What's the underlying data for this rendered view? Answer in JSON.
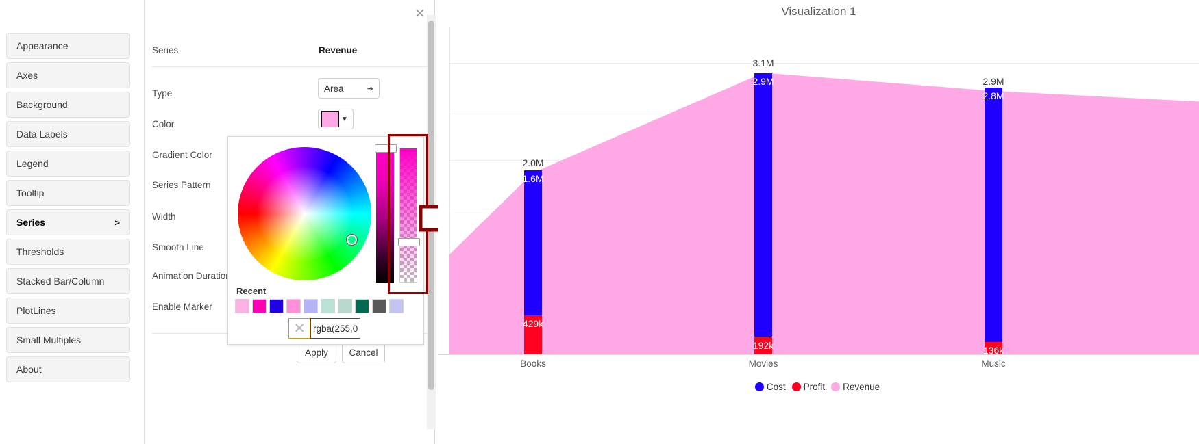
{
  "modal": {
    "close_icon": "close-icon",
    "sidebar": [
      {
        "label": "Appearance",
        "active": false
      },
      {
        "label": "Axes",
        "active": false
      },
      {
        "label": "Background",
        "active": false
      },
      {
        "label": "Data Labels",
        "active": false
      },
      {
        "label": "Legend",
        "active": false
      },
      {
        "label": "Tooltip",
        "active": false
      },
      {
        "label": "Series",
        "active": true,
        "chevron": ">"
      },
      {
        "label": "Thresholds",
        "active": false
      },
      {
        "label": "Stacked Bar/Column",
        "active": false
      },
      {
        "label": "PlotLines",
        "active": false
      },
      {
        "label": "Small Multiples",
        "active": false
      },
      {
        "label": "About",
        "active": false
      }
    ],
    "panel": {
      "series_label": "Series",
      "series_value": "Revenue",
      "rows": [
        {
          "label": "Type"
        },
        {
          "label": "Color"
        },
        {
          "label": "Gradient Color"
        },
        {
          "label": "Series Pattern"
        },
        {
          "label": "Width"
        },
        {
          "label": "Smooth Line"
        },
        {
          "label": "Animation Duration (m"
        },
        {
          "label": "Enable Marker"
        }
      ],
      "type_value": "Area",
      "type_caret": "chevron-down-icon",
      "color_value": "#ffa8e6",
      "color_caret": "▼",
      "apply_label": "Apply",
      "cancel_label": "Cancel"
    }
  },
  "color_picker": {
    "recent_label": "Recent",
    "recent_colors": [
      "#f9b2e2",
      "#ff00b4",
      "#1f00e0",
      "#ff8fd9",
      "#b3b3f5",
      "#b9e2d9",
      "#b9d9cf",
      "#006b50",
      "#595959",
      "#c3c3f2"
    ],
    "rgba_value": "rgba(255,0",
    "clear_icon": "clear-color-icon",
    "selected_color": "#ff00c8",
    "highlight_color": "#8b0000"
  },
  "annotation": {
    "arrow_color": "#8b0000",
    "arrow_name": "pointer-arrow-annotation"
  },
  "chart_data": {
    "type": "bar",
    "title": "Visualization 1",
    "xlabel": "",
    "ylabel": "",
    "categories": [
      "Books",
      "Movies",
      "Music"
    ],
    "grid": true,
    "legend_position": "bottom",
    "series": [
      {
        "name": "Cost",
        "color": "#1f00ff",
        "values": [
          1600000,
          2900000,
          2800000
        ],
        "labels": [
          "1.6M",
          "2.9M",
          "2.8M"
        ]
      },
      {
        "name": "Profit",
        "color": "#ff0020",
        "values": [
          429000,
          192000,
          136000
        ],
        "labels": [
          "429k",
          "192k",
          "136k"
        ]
      },
      {
        "name": "Revenue",
        "color": "#ffa8e6",
        "values": [
          2000000,
          3100000,
          2900000
        ],
        "labels": [
          "2.0M",
          "3.1M",
          "2.9M"
        ]
      }
    ],
    "total_labels": [
      "2.0M",
      "3.1M",
      "2.9M"
    ],
    "ylim": [
      0,
      3600000
    ]
  }
}
